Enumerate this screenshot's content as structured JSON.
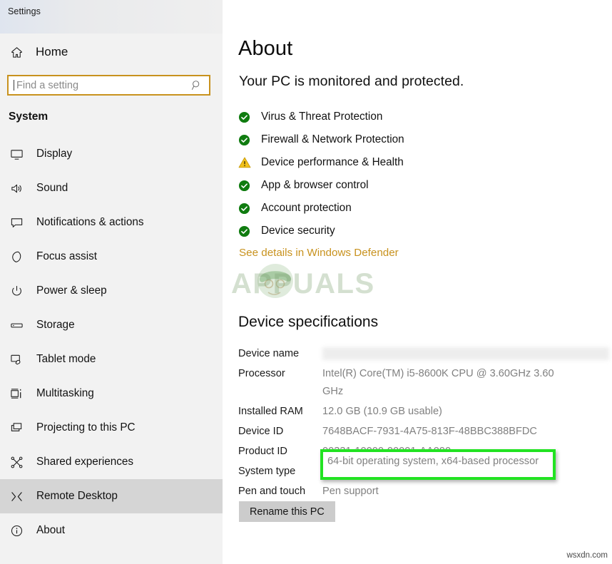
{
  "window": {
    "title": "Settings"
  },
  "sidebar": {
    "home_label": "Home",
    "home_icon": "home-icon",
    "search": {
      "placeholder": "Find a setting",
      "value": "",
      "icon": "search-icon",
      "border_color": "#c8921e"
    },
    "group_title": "System",
    "items": [
      {
        "label": "Display",
        "icon": "monitor-icon",
        "selected": false
      },
      {
        "label": "Sound",
        "icon": "speaker-icon",
        "selected": false
      },
      {
        "label": "Notifications & actions",
        "icon": "callout-icon",
        "selected": false
      },
      {
        "label": "Focus assist",
        "icon": "moon-icon",
        "selected": false
      },
      {
        "label": "Power & sleep",
        "icon": "power-icon",
        "selected": false
      },
      {
        "label": "Storage",
        "icon": "drive-icon",
        "selected": false
      },
      {
        "label": "Tablet mode",
        "icon": "tablet-touch-icon",
        "selected": false
      },
      {
        "label": "Multitasking",
        "icon": "multitask-icon",
        "selected": false
      },
      {
        "label": "Projecting to this PC",
        "icon": "project-icon",
        "selected": false
      },
      {
        "label": "Shared experiences",
        "icon": "share-nodes-icon",
        "selected": false
      },
      {
        "label": "Remote Desktop",
        "icon": "remote-desktop-icon",
        "selected": true
      },
      {
        "label": "About",
        "icon": "info-icon",
        "selected": false
      }
    ]
  },
  "main": {
    "page_title": "About",
    "subtitle": "Your PC is monitored and protected.",
    "security_items": [
      {
        "label": "Virus & Threat Protection",
        "status": "ok",
        "icon": "check-circle-icon"
      },
      {
        "label": "Firewall & Network Protection",
        "status": "ok",
        "icon": "check-circle-icon"
      },
      {
        "label": "Device performance & Health",
        "status": "warning",
        "icon": "warning-triangle-icon"
      },
      {
        "label": "App & browser control",
        "status": "ok",
        "icon": "check-circle-icon"
      },
      {
        "label": "Account protection",
        "status": "ok",
        "icon": "check-circle-icon"
      },
      {
        "label": "Device security",
        "status": "ok",
        "icon": "check-circle-icon"
      }
    ],
    "status_colors": {
      "ok": "#107c10",
      "warning": "#e8a80c"
    },
    "defender_link": "See details in Windows Defender",
    "watermark_text": "APPUALS",
    "specs_title": "Device specifications",
    "specs": [
      {
        "key": "Device name",
        "value": "",
        "redacted": true
      },
      {
        "key": "Processor",
        "value": "Intel(R) Core(TM) i5-8600K CPU @ 3.60GHz   3.60\nGHz",
        "redacted": false
      },
      {
        "key": "Installed RAM",
        "value": "12.0 GB (10.9 GB usable)",
        "redacted": false
      },
      {
        "key": "Device ID",
        "value": "7648BACF-7931-4A75-813F-48BBC388BFDC",
        "redacted": false
      },
      {
        "key": "Product ID",
        "value": "00331-10000-00001-AA090",
        "redacted": false
      },
      {
        "key": "System type",
        "value": "64-bit operating system, x64-based processor",
        "redacted": false
      },
      {
        "key": "Pen and touch",
        "value": "Pen support",
        "redacted": false
      }
    ],
    "rename_button": "Rename this PC",
    "highlight": {
      "text": "64-bit operating system, x64-based processor",
      "color": "#22e322"
    }
  },
  "footer": {
    "credit": "wsxdn.com"
  }
}
